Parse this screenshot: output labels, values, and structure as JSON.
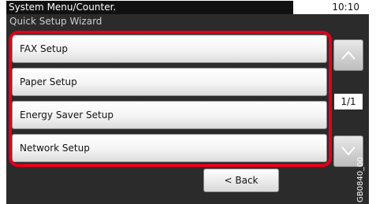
{
  "header": {
    "title": "System Menu/Counter.",
    "time": "10:10"
  },
  "panel": {
    "subtitle": "Quick Setup Wizard"
  },
  "menu": {
    "items": [
      {
        "label": "FAX Setup"
      },
      {
        "label": "Paper Setup"
      },
      {
        "label": "Energy Saver Setup"
      },
      {
        "label": "Network Setup"
      }
    ]
  },
  "pager": {
    "indicator": "1/1"
  },
  "footer": {
    "back_label": "< Back"
  },
  "figure": {
    "ref_code": "GB0840_00"
  },
  "colors": {
    "highlight": "#e0001b",
    "panel": "#2b2b2b",
    "title_bar": "#111111"
  },
  "icons": {
    "scroll_up": "chevron-up-icon",
    "scroll_down": "chevron-down-icon"
  }
}
